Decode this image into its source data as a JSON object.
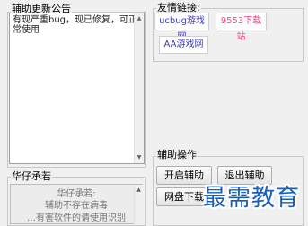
{
  "announcement": {
    "title": "辅助更新公告",
    "text": "有现严重bug，现已修复，可正常使用"
  },
  "friend_links": {
    "title": "友情链接:",
    "links": [
      {
        "label": "ucbug游戏网",
        "color": "#3a3ab8"
      },
      {
        "label": "9553下载站",
        "color": "#ff3f8c"
      },
      {
        "label": "AA游戏网",
        "color": "#3a3ab8"
      }
    ]
  },
  "helper_ops": {
    "title": "辅助操作",
    "start_label": "开启辅助",
    "exit_label": "退出辅助",
    "netdisk_label": "网盘下载"
  },
  "promise": {
    "title": "华仔承若",
    "lines": [
      "华仔承若:",
      "辅助不存在病毒",
      "…有害软件的请使用识别"
    ]
  },
  "watermark": {
    "text": "最需教育"
  }
}
